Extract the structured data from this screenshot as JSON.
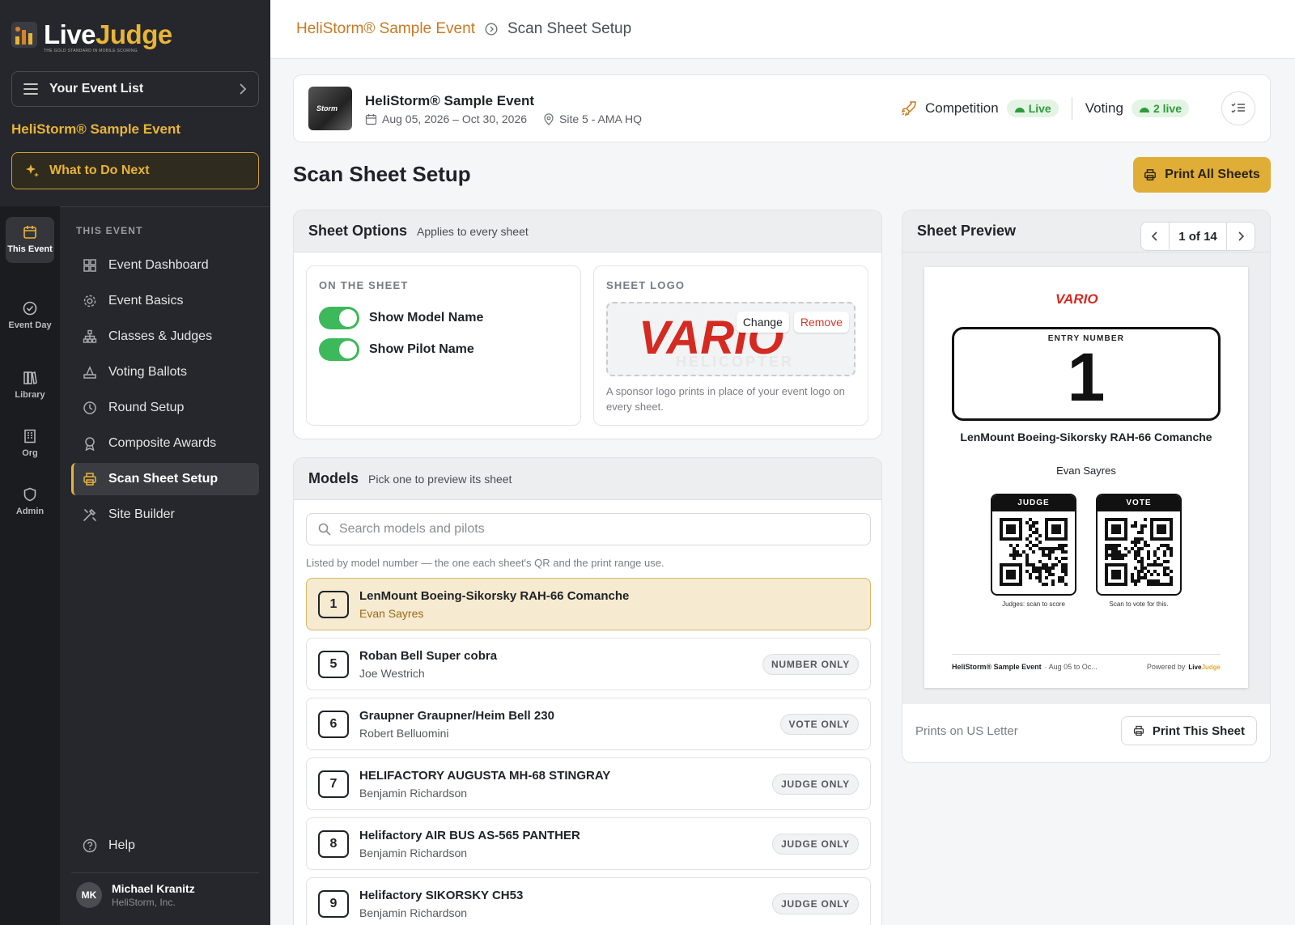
{
  "brand": {
    "name_a": "Live",
    "name_b": "Judge",
    "tagline": "THE GOLD STANDARD IN MOBILE SCORING"
  },
  "sidebar": {
    "event_list_label": "Your Event List",
    "event_name": "HeliStorm® Sample Event",
    "what_next_label": "What to Do Next",
    "rail": [
      {
        "label": "This Event",
        "icon": "calendar-icon"
      },
      {
        "label": "Event Day",
        "icon": "check-circle-icon"
      },
      {
        "label": "Library",
        "icon": "books-icon"
      },
      {
        "label": "Org",
        "icon": "building-icon"
      },
      {
        "label": "Admin",
        "icon": "shield-icon"
      }
    ],
    "section_label": "THIS EVENT",
    "items": [
      {
        "label": "Event Dashboard",
        "icon": "grid-icon"
      },
      {
        "label": "Event Basics",
        "icon": "gear-icon"
      },
      {
        "label": "Classes & Judges",
        "icon": "hierarchy-icon"
      },
      {
        "label": "Voting Ballots",
        "icon": "ballot-icon"
      },
      {
        "label": "Round Setup",
        "icon": "clock-icon"
      },
      {
        "label": "Composite Awards",
        "icon": "award-icon"
      },
      {
        "label": "Scan Sheet Setup",
        "icon": "printer-icon"
      },
      {
        "label": "Site Builder",
        "icon": "tools-icon"
      }
    ],
    "help_label": "Help",
    "user": {
      "initials": "MK",
      "name": "Michael Kranitz",
      "org": "HeliStorm, Inc."
    }
  },
  "breadcrumb": {
    "event": "HeliStorm® Sample Event",
    "page": "Scan Sheet Setup"
  },
  "event": {
    "thumb_text": "Storm",
    "title": "HeliStorm® Sample Event",
    "dates": "Aug 05, 2026 – Oct 30, 2026",
    "site": "Site 5 - AMA HQ",
    "competition_label": "Competition",
    "competition_status": "Live",
    "voting_label": "Voting",
    "voting_status": "2 live"
  },
  "page_title": "Scan Sheet Setup",
  "print_all_label": "Print All Sheets",
  "sheet_options": {
    "title": "Sheet Options",
    "subtitle": "Applies to every sheet",
    "on_sheet_label": "ON THE SHEET",
    "toggles": [
      {
        "label": "Show Model Name",
        "on": true
      },
      {
        "label": "Show Pilot Name",
        "on": true
      }
    ],
    "logo_label": "SHEET LOGO",
    "logo_word": "VARIO",
    "logo_sub": "HELICOPTER",
    "change_label": "Change",
    "remove_label": "Remove",
    "logo_note": "A sponsor logo prints in place of your event logo on every sheet."
  },
  "models": {
    "title": "Models",
    "subtitle": "Pick one to preview its sheet",
    "search_placeholder": "Search models and pilots",
    "note": "Listed by model number — the one each sheet's QR and the print range use.",
    "rows": [
      {
        "num": "1",
        "name": "LenMount Boeing-Sikorsky RAH-66 Comanche",
        "pilot": "Evan Sayres",
        "badge": ""
      },
      {
        "num": "5",
        "name": "Roban Bell Super cobra",
        "pilot": "Joe Westrich",
        "badge": "NUMBER ONLY"
      },
      {
        "num": "6",
        "name": "Graupner Graupner/Heim Bell 230",
        "pilot": "Robert Belluomini",
        "badge": "VOTE ONLY"
      },
      {
        "num": "7",
        "name": "HELIFACTORY AUGUSTA MH-68 STINGRAY",
        "pilot": "Benjamin Richardson",
        "badge": "JUDGE ONLY"
      },
      {
        "num": "8",
        "name": "Helifactory AIR BUS AS-565 PANTHER",
        "pilot": "Benjamin Richardson",
        "badge": "JUDGE ONLY"
      },
      {
        "num": "9",
        "name": "Helifactory SIKORSKY CH53",
        "pilot": "Benjamin Richardson",
        "badge": "JUDGE ONLY"
      }
    ]
  },
  "preview": {
    "title": "Sheet Preview",
    "pager": "1 of 14",
    "sheet": {
      "logo": "VARIO",
      "entry_label": "ENTRY NUMBER",
      "entry_number": "1",
      "model": "LenMount Boeing-Sikorsky RAH-66 Comanche",
      "pilot": "Evan Sayres",
      "judge_label": "JUDGE",
      "vote_label": "VOTE",
      "judge_caption": "Judges: scan to score",
      "vote_caption": "Scan to vote for this.",
      "footer_event": "HeliStorm® Sample Event",
      "footer_dates": "· Aug 05 to Oc...",
      "powered_by": "Powered by",
      "powered_logo_a": "Live",
      "powered_logo_b": "Judge"
    },
    "prints_on": "Prints on US Letter",
    "print_this_label": "Print This Sheet"
  },
  "colors": {
    "accent": "#e0ad37",
    "sidebar": "#25272c",
    "live_green": "#2f9a3e",
    "toggle_green": "#3db85a",
    "crumb_orange": "#c77a22"
  }
}
